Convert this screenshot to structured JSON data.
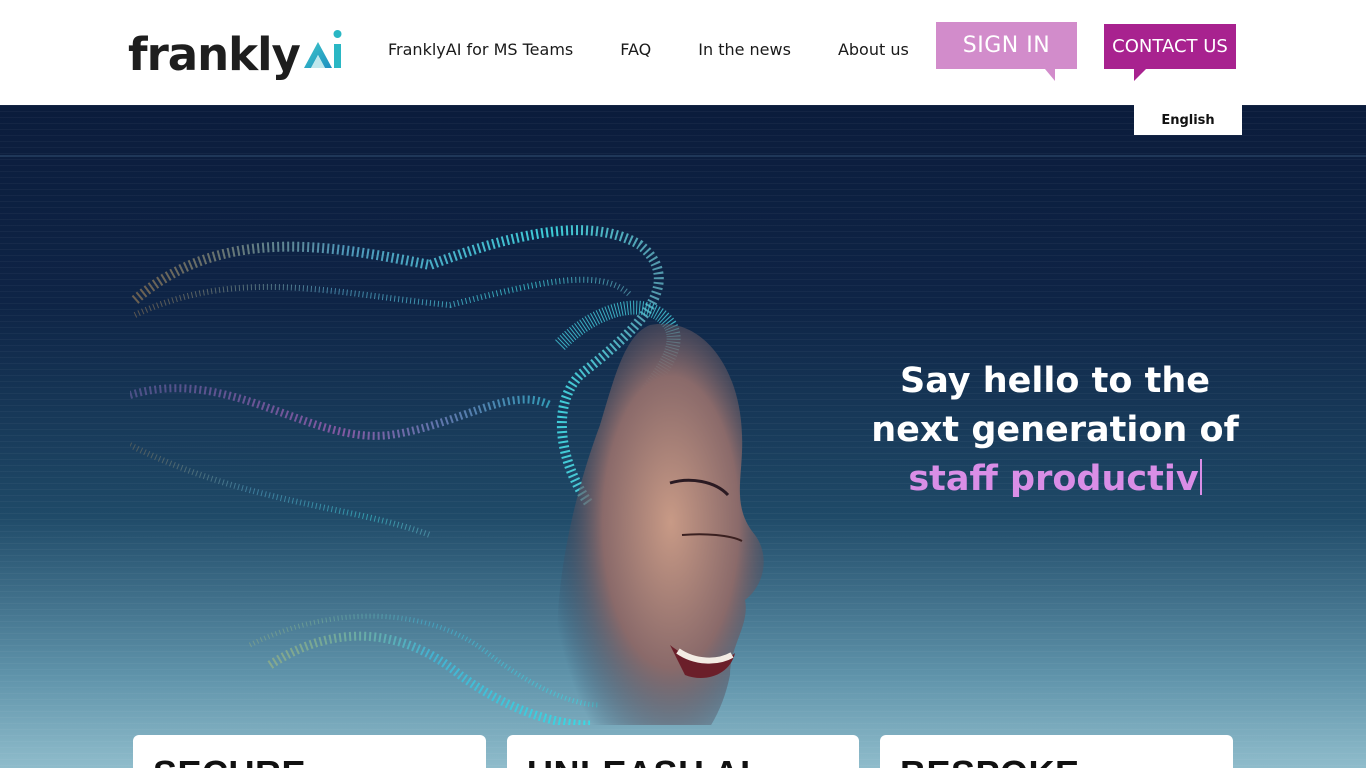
{
  "brand": {
    "logo_text": "frankly",
    "logo_mark": "AI"
  },
  "nav": {
    "items": [
      {
        "label": "FranklyAI for MS Teams"
      },
      {
        "label": "FAQ"
      },
      {
        "label": "In the news"
      },
      {
        "label": "About us"
      }
    ]
  },
  "actions": {
    "sign_in": "SIGN IN",
    "contact": "CONTACT US"
  },
  "language": {
    "selected": "English"
  },
  "hero": {
    "line1": "Say hello to the",
    "line2": "next generation of",
    "typed": "staff productiv"
  },
  "cards": [
    {
      "title": "SECURE"
    },
    {
      "title": "UNLEASH AI"
    },
    {
      "title": "BESPOKE"
    }
  ],
  "colors": {
    "accent_light": "#d28ccb",
    "accent_dark": "#a8228f",
    "typed_text": "#d98ee6",
    "hero_dark": "#0b1c3c",
    "logo_teal": "#2ab7c4"
  },
  "icons": {
    "hero_image": "woman-face-particle-wave-illustration"
  }
}
